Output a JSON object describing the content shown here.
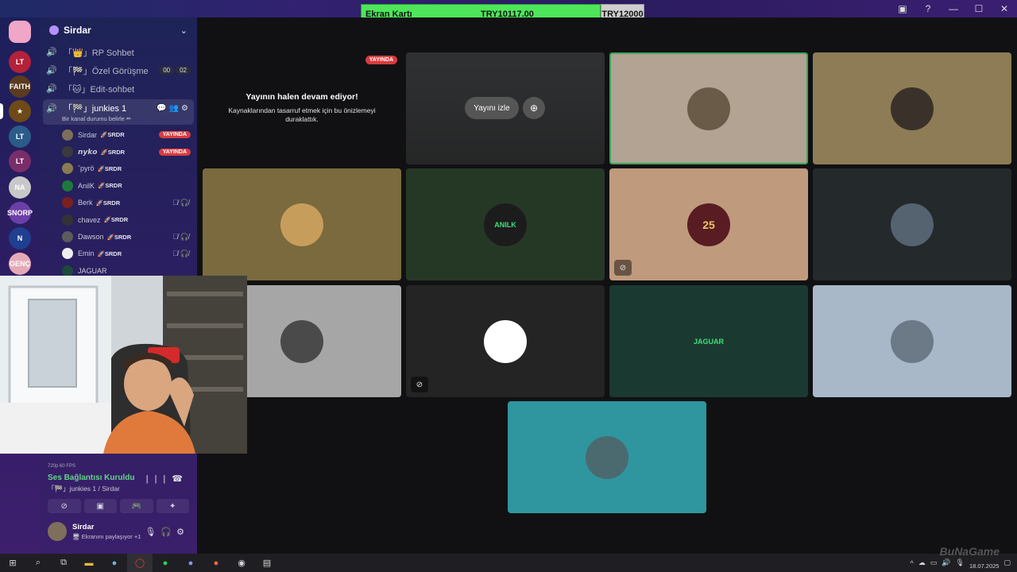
{
  "topbar": {
    "product_label": "Ekran Kartı",
    "current_price": "TRY10117.00",
    "target_price": "TRY12000"
  },
  "window": {
    "inbox_icon": "inbox-icon",
    "help_icon": "help-icon",
    "minimize": "—",
    "maximize": "☐",
    "close": "✕"
  },
  "rail": {
    "servers": [
      {
        "label": "",
        "color": "#f0a6c6"
      },
      {
        "label": "LT",
        "color": "#b3223a"
      },
      {
        "label": "FAITH",
        "color": "#5a3b1f"
      },
      {
        "label": "★",
        "color": "#6d4a17"
      },
      {
        "label": "LT",
        "color": "#2b5c88"
      },
      {
        "label": "LT",
        "color": "#7b2d6a"
      },
      {
        "label": "NA",
        "color": "#c8c8c8"
      },
      {
        "label": "SNORP",
        "color": "#6b3fa7"
      },
      {
        "label": "N",
        "color": "#1f3f8f"
      },
      {
        "label": "GENÇ",
        "color": "#e5aab8"
      }
    ]
  },
  "guild": {
    "name": "Sirdar"
  },
  "channels": [
    {
      "name": "「👑」RP Sohbet"
    },
    {
      "name": "「🏁」Özel Görüşme",
      "counts": [
        "00",
        "02"
      ]
    },
    {
      "name": "「🐱」Edit-sohbet"
    }
  ],
  "active_channel": {
    "name": "「🏁」junkies 1",
    "status": "Bir kanal durumu belirle ✏"
  },
  "voice_users": [
    {
      "name": "Sirdar",
      "tag": "🚀SRDR",
      "live": "YAYINDA",
      "color": "#7e6f5c"
    },
    {
      "name": "𝙣𝙮𝙠𝙤",
      "tag": "🚀SRDR",
      "live": "YAYINDA",
      "color": "#3a3a3a"
    },
    {
      "name": "ˇpyrö",
      "tag": "🚀SRDR",
      "color": "#8a7a52"
    },
    {
      "name": "AnilK",
      "tag": "🚀SRDR",
      "color": "#1e7a3c"
    },
    {
      "name": "Berk",
      "tag": "🚀SRDR",
      "muted": "🎙̸ 🎧̸",
      "color": "#7a2020"
    },
    {
      "name": "chavez",
      "tag": "🚀SRDR",
      "color": "#333"
    },
    {
      "name": "Dawson",
      "tag": "🚀SRDR",
      "muted": "🎙̸ 🎧̸",
      "color": "#5c5c5c"
    },
    {
      "name": "Emin",
      "tag": "🚀SRDR",
      "muted": "🎙̸ 🎧̸",
      "color": "#eeeeee"
    },
    {
      "name": "JAGUAR",
      "color": "#1d4a3a"
    }
  ],
  "voice_status": {
    "connected": "Ses Bağlantısı Kuruldu",
    "location": "「🏁」junkies 1 / Sirdar",
    "fps": "720p 60 FPS"
  },
  "user": {
    "name": "Sirdar",
    "activity": "🖥 Ekranını paylaşıyor +1"
  },
  "stream": {
    "live_badge": "YAYINDA",
    "heading": "Yayının halen devam ediyor!",
    "body": "Kaynaklarından tasarruf etmek için bu önizlemeyi duraklattık.",
    "watch_label": "Yayını izle"
  },
  "tiles": [
    {
      "bg": "#2a2a2c",
      "type": "preview"
    },
    {
      "bg": "#b2a392",
      "avatar": "#6a5a48",
      "speaking": true
    },
    {
      "bg": "#8d7c55",
      "avatar": "#3a322a"
    },
    {
      "bg": "#7a6a3e",
      "avatar": "#c79d5b"
    },
    {
      "bg": "#253826",
      "avatar": "#1c1c1c",
      "text": "ANILK"
    },
    {
      "bg": "#bf9a7c",
      "avatar": "#581c22",
      "text": "25",
      "muted": true
    },
    {
      "bg": "#24292b",
      "avatar": "#556270"
    },
    {
      "bg": "#a6a6a6",
      "avatar": "#4a4a4a"
    },
    {
      "bg": "#242424",
      "avatar": "#ffffff",
      "muted": true
    },
    {
      "bg": "#1a3a31",
      "avatar": "#1a3a31",
      "text": "JAGUAR"
    },
    {
      "bg": "#a8b8c9",
      "avatar": "#6c7a88"
    },
    {
      "bg": "#2f959e",
      "avatar": "#4a6a70"
    }
  ],
  "taskbar": {
    "clock_date": "18.07.2025"
  },
  "watermark": "BuNaGame"
}
